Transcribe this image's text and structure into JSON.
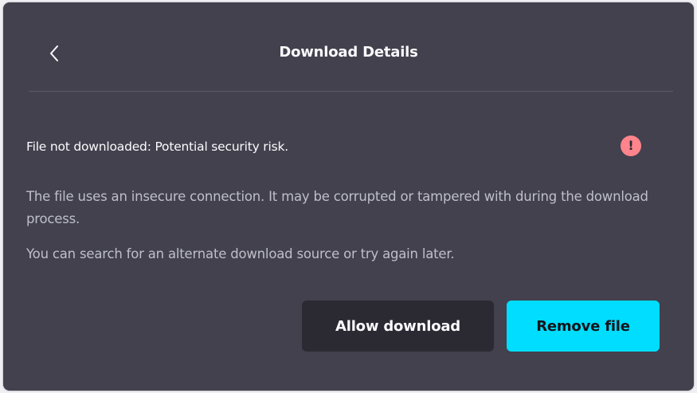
{
  "dialog": {
    "title": "Download Details",
    "status": "File not downloaded: Potential security risk.",
    "description_1": "The file uses an insecure connection. It may be corrupted or tampered with during the download process.",
    "description_2": "You can search for an alternate download source or try again later.",
    "warning_symbol": "!",
    "back_icon": "chevron-left-icon"
  },
  "buttons": {
    "allow_label": "Allow download",
    "remove_label": "Remove file"
  },
  "colors": {
    "panel_background": "#42414d",
    "primary_button": "#00ddff",
    "secondary_button": "#2b2a33",
    "warning": "#ff848b"
  }
}
